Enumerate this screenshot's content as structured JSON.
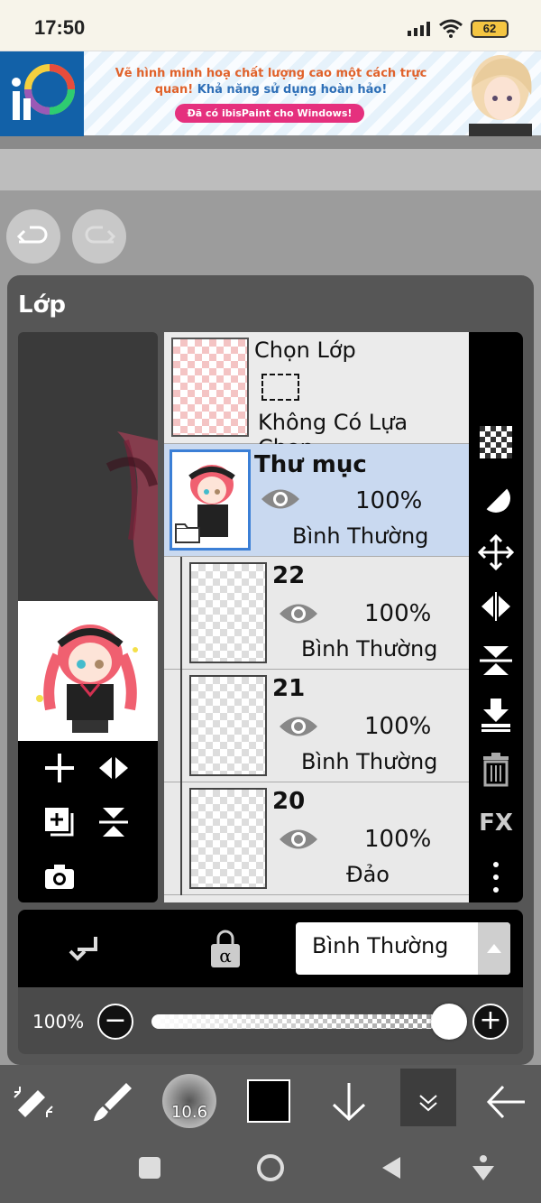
{
  "status": {
    "time": "17:50",
    "battery": "62"
  },
  "ad": {
    "line1a": "Vẽ hình minh hoạ chất lượng cao một cách trực quan!",
    "line1b": " Khả năng sử dụng hoàn hảo!",
    "cta": "Đã có ibisPaint cho Windows!"
  },
  "panel": {
    "title": "Lớp"
  },
  "selection_layer": {
    "name": "Chọn Lớp",
    "state": "Không Có Lựa Chọn"
  },
  "layers": [
    {
      "name": "Thư mục",
      "opacity": "100%",
      "mode": "Bình Thường",
      "selected": true
    },
    {
      "name": "22",
      "opacity": "100%",
      "mode": "Bình Thường"
    },
    {
      "name": "21",
      "opacity": "100%",
      "mode": "Bình Thường"
    },
    {
      "name": "20",
      "opacity": "100%",
      "mode": "Đảo"
    }
  ],
  "blend": {
    "mode": "Bình Thường"
  },
  "opacity": {
    "label": "100%",
    "value": 1.0
  },
  "brush": {
    "size": "10.6"
  },
  "colors": {
    "accent": "#2e6fb7",
    "selected_layer": "#c9d9f0",
    "current_color": "#000000"
  },
  "side_tool_icons": [
    "transparency-icon",
    "clipping-icon",
    "move-icon",
    "flip-horizontal-icon",
    "flip-vertical-icon",
    "merge-down-icon",
    "trash-icon",
    "fx-icon",
    "more-icon"
  ],
  "side_fx_label": "FX"
}
